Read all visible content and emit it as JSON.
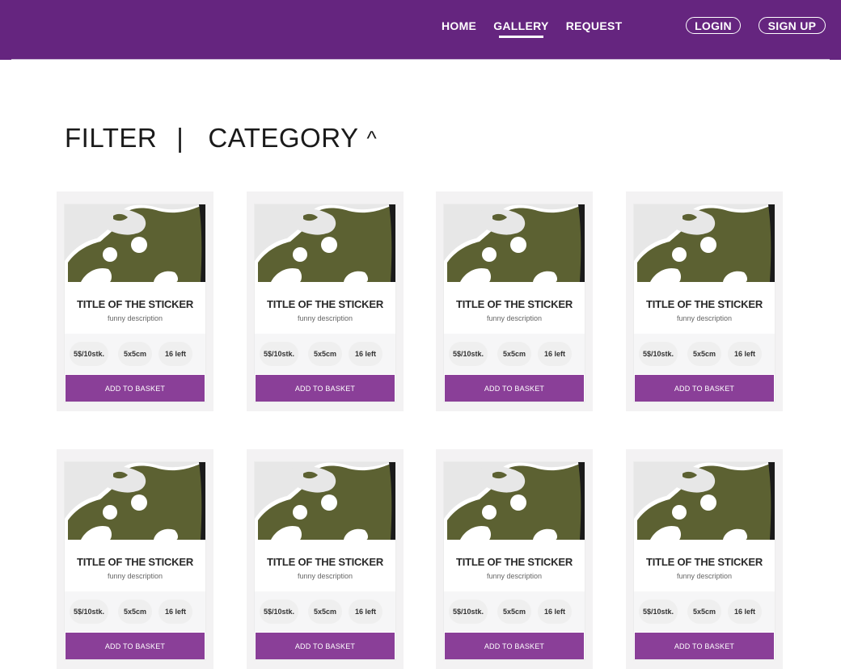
{
  "nav": {
    "links": [
      {
        "label": "HOME",
        "active": false
      },
      {
        "label": "GALLERY",
        "active": true
      },
      {
        "label": "REQUEST",
        "active": false
      }
    ],
    "login_label": "LOGIN",
    "signup_label": "SIGN UP"
  },
  "filter": {
    "filter_label": "FILTER",
    "separator": "|",
    "category_label": "CATEGORY",
    "caret": "^"
  },
  "cards": [
    {
      "title": "TITLE OF THE STICKER",
      "description": "funny description",
      "price": "5$/10stk.",
      "size": "5x5cm",
      "stock": "16 left",
      "button": "ADD TO BASKET"
    },
    {
      "title": "TITLE OF THE STICKER",
      "description": "funny description",
      "price": "5$/10stk.",
      "size": "5x5cm",
      "stock": "16 left",
      "button": "ADD TO BASKET"
    },
    {
      "title": "TITLE OF THE STICKER",
      "description": "funny description",
      "price": "5$/10stk.",
      "size": "5x5cm",
      "stock": "16 left",
      "button": "ADD TO BASKET"
    },
    {
      "title": "TITLE OF THE STICKER",
      "description": "funny description",
      "price": "5$/10stk.",
      "size": "5x5cm",
      "stock": "16 left",
      "button": "ADD TO BASKET"
    },
    {
      "title": "TITLE OF THE STICKER",
      "description": "funny description",
      "price": "5$/10stk.",
      "size": "5x5cm",
      "stock": "16 left",
      "button": "ADD TO BASKET"
    },
    {
      "title": "TITLE OF THE STICKER",
      "description": "funny description",
      "price": "5$/10stk.",
      "size": "5x5cm",
      "stock": "16 left",
      "button": "ADD TO BASKET"
    },
    {
      "title": "TITLE OF THE STICKER",
      "description": "funny description",
      "price": "5$/10stk.",
      "size": "5x5cm",
      "stock": "16 left",
      "button": "ADD TO BASKET"
    },
    {
      "title": "TITLE OF THE STICKER",
      "description": "funny description",
      "price": "5$/10stk.",
      "size": "5x5cm",
      "stock": "16 left",
      "button": "ADD TO BASKET"
    }
  ],
  "colors": {
    "brand": "#65257f",
    "button": "#8a3f98",
    "sticker_green": "#5c6132"
  },
  "icons": {
    "sticker_image": "panda-sticker-image"
  }
}
